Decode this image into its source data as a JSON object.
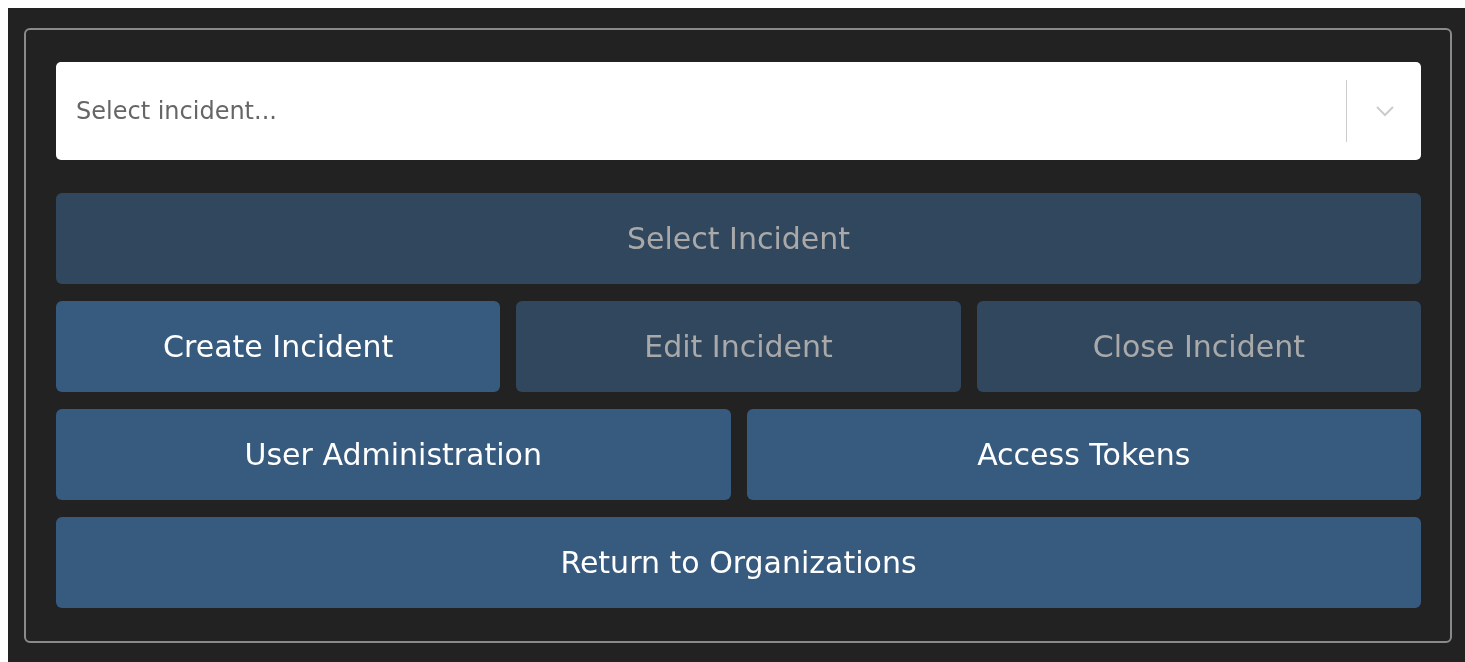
{
  "incident_select": {
    "placeholder": "Select incident..."
  },
  "button_rows": [
    [
      {
        "label": "Select Incident",
        "disabled": true
      }
    ],
    [
      {
        "label": "Create Incident",
        "disabled": false
      },
      {
        "label": "Edit Incident",
        "disabled": true
      },
      {
        "label": "Close Incident",
        "disabled": true
      }
    ],
    [
      {
        "label": "User Administration",
        "disabled": false
      },
      {
        "label": "Access Tokens",
        "disabled": false
      }
    ],
    [
      {
        "label": "Return to Organizations",
        "disabled": false
      }
    ]
  ]
}
